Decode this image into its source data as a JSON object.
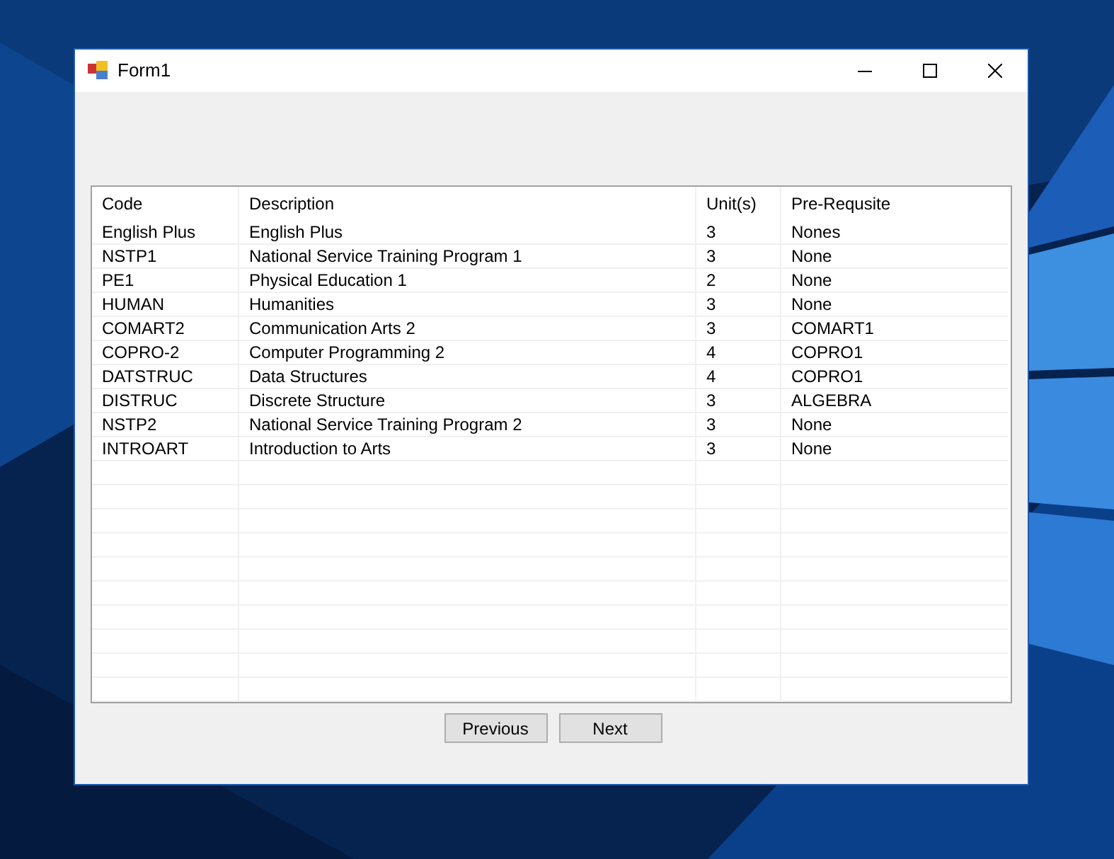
{
  "window": {
    "title": "Form1"
  },
  "table": {
    "columns": [
      "Code",
      "Description",
      "Unit(s)",
      "Pre-Requsite"
    ],
    "rows": [
      [
        "English Plus",
        "English Plus",
        "3",
        "Nones"
      ],
      [
        "NSTP1",
        "National Service Training Program 1",
        "3",
        "None"
      ],
      [
        "PE1",
        "Physical Education 1",
        "2",
        "None"
      ],
      [
        "HUMAN",
        "Humanities",
        "3",
        "None"
      ],
      [
        "COMART2",
        "Communication Arts 2",
        "3",
        "COMART1"
      ],
      [
        "COPRO-2",
        "Computer Programming 2",
        "4",
        "COPRO1"
      ],
      [
        "DATSTRUC",
        "Data Structures",
        "4",
        "COPRO1"
      ],
      [
        "DISTRUC",
        "Discrete Structure",
        "3",
        "ALGEBRA"
      ],
      [
        "NSTP2",
        "National Service Training Program 2",
        "3",
        "None"
      ],
      [
        "INTROART",
        "Introduction to Arts",
        "3",
        "None"
      ]
    ]
  },
  "buttons": [
    "Previous",
    "Next"
  ]
}
